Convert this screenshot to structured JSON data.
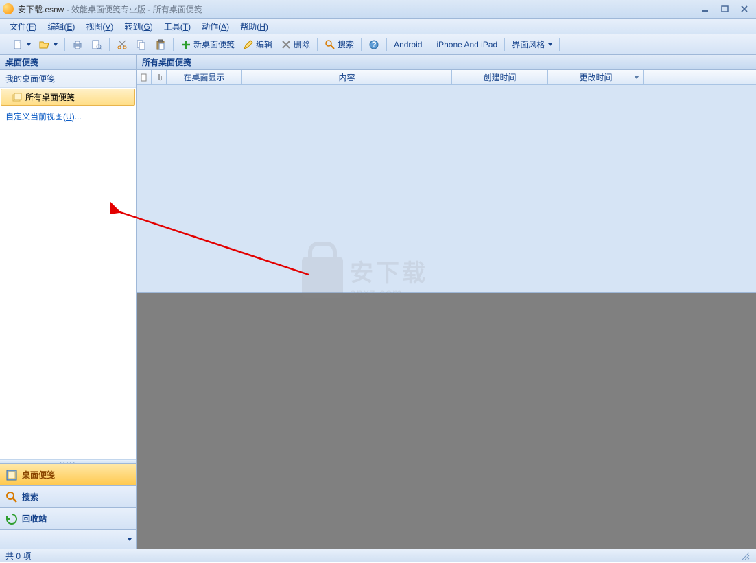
{
  "titlebar": {
    "filename": "安下载.esnw",
    "app_title": " - 效能桌面便笺专业版 - 所有桌面便笺"
  },
  "menubar": [
    {
      "label": "文件",
      "key": "F"
    },
    {
      "label": "编辑",
      "key": "E"
    },
    {
      "label": "视图",
      "key": "V"
    },
    {
      "label": "转到",
      "key": "G"
    },
    {
      "label": "工具",
      "key": "T"
    },
    {
      "label": "动作",
      "key": "A"
    },
    {
      "label": "帮助",
      "key": "H"
    }
  ],
  "toolbar": {
    "new_note_label": "新桌面便笺",
    "edit_label": "编辑",
    "delete_label": "删除",
    "search_label": "搜索",
    "android_label": "Android",
    "iphone_label": "iPhone And iPad",
    "style_label": "界面风格"
  },
  "sidebar": {
    "header": "桌面便笺",
    "group_label": "我的桌面便笺",
    "all_notes_label": "所有桌面便笺",
    "custom_view_label": "自定义当前视图",
    "custom_view_key": "U",
    "custom_view_suffix": "...",
    "nav": {
      "notes": "桌面便笺",
      "search": "搜索",
      "recycle": "回收站"
    }
  },
  "content": {
    "header": "所有桌面便笺",
    "columns": {
      "show_on_desktop": "在桌面显示",
      "content": "内容",
      "create_time": "创建时间",
      "modify_time": "更改时间"
    }
  },
  "statusbar": {
    "count_text": "共 0 项"
  },
  "watermark": {
    "cn": "安下载",
    "en": "anxz.com"
  }
}
